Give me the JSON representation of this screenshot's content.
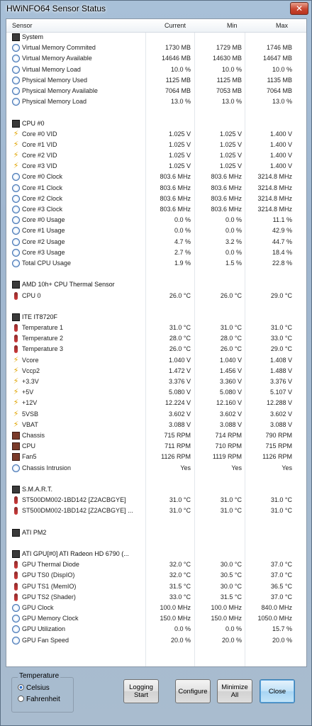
{
  "window": {
    "title": "HWiNFO64 Sensor Status"
  },
  "columns": {
    "sensor": "Sensor",
    "current": "Current",
    "min": "Min",
    "max": "Max"
  },
  "rows": [
    {
      "type": "group",
      "icon": "chip",
      "name": "System"
    },
    {
      "icon": "clock",
      "name": "Virtual Memory Commited",
      "cur": "1730 MB",
      "min": "1729 MB",
      "max": "1746 MB"
    },
    {
      "icon": "clock",
      "name": "Virtual Memory Available",
      "cur": "14646 MB",
      "min": "14630 MB",
      "max": "14647 MB"
    },
    {
      "icon": "clock",
      "name": "Virtual Memory Load",
      "cur": "10.0 %",
      "min": "10.0 %",
      "max": "10.0 %"
    },
    {
      "icon": "clock",
      "name": "Physical Memory Used",
      "cur": "1125 MB",
      "min": "1125 MB",
      "max": "1135 MB"
    },
    {
      "icon": "clock",
      "name": "Physical Memory Available",
      "cur": "7064 MB",
      "min": "7053 MB",
      "max": "7064 MB"
    },
    {
      "icon": "clock",
      "name": "Physical Memory Load",
      "cur": "13.0 %",
      "min": "13.0 %",
      "max": "13.0 %"
    },
    {
      "type": "spacer"
    },
    {
      "type": "group",
      "icon": "chip",
      "name": "CPU #0"
    },
    {
      "icon": "volt",
      "name": "Core #0 VID",
      "cur": "1.025 V",
      "min": "1.025 V",
      "max": "1.400 V"
    },
    {
      "icon": "volt",
      "name": "Core #1 VID",
      "cur": "1.025 V",
      "min": "1.025 V",
      "max": "1.400 V"
    },
    {
      "icon": "volt",
      "name": "Core #2 VID",
      "cur": "1.025 V",
      "min": "1.025 V",
      "max": "1.400 V"
    },
    {
      "icon": "volt",
      "name": "Core #3 VID",
      "cur": "1.025 V",
      "min": "1.025 V",
      "max": "1.400 V"
    },
    {
      "icon": "clock",
      "name": "Core #0 Clock",
      "cur": "803.6 MHz",
      "min": "803.6 MHz",
      "max": "3214.8 MHz"
    },
    {
      "icon": "clock",
      "name": "Core #1 Clock",
      "cur": "803.6 MHz",
      "min": "803.6 MHz",
      "max": "3214.8 MHz"
    },
    {
      "icon": "clock",
      "name": "Core #2 Clock",
      "cur": "803.6 MHz",
      "min": "803.6 MHz",
      "max": "3214.8 MHz"
    },
    {
      "icon": "clock",
      "name": "Core #3 Clock",
      "cur": "803.6 MHz",
      "min": "803.6 MHz",
      "max": "3214.8 MHz"
    },
    {
      "icon": "clock",
      "name": "Core #0 Usage",
      "cur": "0.0 %",
      "min": "0.0 %",
      "max": "11.1 %"
    },
    {
      "icon": "clock",
      "name": "Core #1 Usage",
      "cur": "0.0 %",
      "min": "0.0 %",
      "max": "42.9 %"
    },
    {
      "icon": "clock",
      "name": "Core #2 Usage",
      "cur": "4.7 %",
      "min": "3.2 %",
      "max": "44.7 %"
    },
    {
      "icon": "clock",
      "name": "Core #3 Usage",
      "cur": "2.7 %",
      "min": "0.0 %",
      "max": "18.4 %"
    },
    {
      "icon": "clock",
      "name": "Total CPU Usage",
      "cur": "1.9 %",
      "min": "1.5 %",
      "max": "22.8 %"
    },
    {
      "type": "spacer"
    },
    {
      "type": "group",
      "icon": "chip",
      "name": "AMD 10h+ CPU Thermal Sensor"
    },
    {
      "icon": "temp",
      "name": "CPU 0",
      "cur": "26.0 °C",
      "min": "26.0 °C",
      "max": "29.0 °C"
    },
    {
      "type": "spacer"
    },
    {
      "type": "group",
      "icon": "chip",
      "name": "ITE IT8720F"
    },
    {
      "icon": "temp",
      "name": "Temperature 1",
      "cur": "31.0 °C",
      "min": "31.0 °C",
      "max": "31.0 °C"
    },
    {
      "icon": "temp",
      "name": "Temperature 2",
      "cur": "28.0 °C",
      "min": "28.0 °C",
      "max": "33.0 °C"
    },
    {
      "icon": "temp",
      "name": "Temperature 3",
      "cur": "26.0 °C",
      "min": "26.0 °C",
      "max": "29.0 °C"
    },
    {
      "icon": "volt",
      "name": "Vcore",
      "cur": "1.040 V",
      "min": "1.040 V",
      "max": "1.408 V"
    },
    {
      "icon": "volt",
      "name": "Vccp2",
      "cur": "1.472 V",
      "min": "1.456 V",
      "max": "1.488 V"
    },
    {
      "icon": "volt",
      "name": "+3.3V",
      "cur": "3.376 V",
      "min": "3.360 V",
      "max": "3.376 V"
    },
    {
      "icon": "volt",
      "name": "+5V",
      "cur": "5.080 V",
      "min": "5.080 V",
      "max": "5.107 V"
    },
    {
      "icon": "volt",
      "name": "+12V",
      "cur": "12.224 V",
      "min": "12.160 V",
      "max": "12.288 V"
    },
    {
      "icon": "volt",
      "name": "5VSB",
      "cur": "3.602 V",
      "min": "3.602 V",
      "max": "3.602 V"
    },
    {
      "icon": "volt",
      "name": "VBAT",
      "cur": "3.088 V",
      "min": "3.088 V",
      "max": "3.088 V"
    },
    {
      "icon": "fan",
      "name": "Chassis",
      "cur": "715 RPM",
      "min": "714 RPM",
      "max": "790 RPM"
    },
    {
      "icon": "fan",
      "name": "CPU",
      "cur": "711 RPM",
      "min": "710 RPM",
      "max": "715 RPM"
    },
    {
      "icon": "fan",
      "name": "Fan5",
      "cur": "1126 RPM",
      "min": "1119 RPM",
      "max": "1126 RPM"
    },
    {
      "icon": "clock",
      "name": "Chassis Intrusion",
      "cur": "Yes",
      "min": "Yes",
      "max": "Yes"
    },
    {
      "type": "spacer"
    },
    {
      "type": "group",
      "icon": "chip",
      "name": "S.M.A.R.T."
    },
    {
      "icon": "temp",
      "name": "ST500DM002-1BD142 [Z2ACBGYE]",
      "cur": "31.0 °C",
      "min": "31.0 °C",
      "max": "31.0 °C"
    },
    {
      "icon": "temp",
      "name": "ST500DM002-1BD142 [Z2ACBGYE] ...",
      "cur": "31.0 °C",
      "min": "31.0 °C",
      "max": "31.0 °C"
    },
    {
      "type": "spacer"
    },
    {
      "type": "group",
      "icon": "chip",
      "name": "ATI PM2"
    },
    {
      "type": "spacer"
    },
    {
      "type": "group",
      "icon": "chip",
      "name": "ATI GPU[#0] ATI Radeon HD 6790 (..."
    },
    {
      "icon": "temp",
      "name": "GPU Thermal Diode",
      "cur": "32.0 °C",
      "min": "30.0 °C",
      "max": "37.0 °C"
    },
    {
      "icon": "temp",
      "name": "GPU TS0 (DispIO)",
      "cur": "32.0 °C",
      "min": "30.5 °C",
      "max": "37.0 °C"
    },
    {
      "icon": "temp",
      "name": "GPU TS1 (MemIO)",
      "cur": "31.5 °C",
      "min": "30.0 °C",
      "max": "36.5 °C"
    },
    {
      "icon": "temp",
      "name": "GPU TS2 (Shader)",
      "cur": "33.0 °C",
      "min": "31.5 °C",
      "max": "37.0 °C"
    },
    {
      "icon": "clock",
      "name": "GPU Clock",
      "cur": "100.0 MHz",
      "min": "100.0 MHz",
      "max": "840.0 MHz"
    },
    {
      "icon": "clock",
      "name": "GPU Memory Clock",
      "cur": "150.0 MHz",
      "min": "150.0 MHz",
      "max": "1050.0 MHz"
    },
    {
      "icon": "clock",
      "name": "GPU Utilization",
      "cur": "0.0 %",
      "min": "0.0 %",
      "max": "15.7 %"
    },
    {
      "icon": "clock",
      "name": "GPU Fan Speed",
      "cur": "20.0 %",
      "min": "20.0 %",
      "max": "20.0 %"
    }
  ],
  "temperature": {
    "legend": "Temperature",
    "celsius": "Celsius",
    "fahrenheit": "Fahrenheit",
    "selected": "celsius"
  },
  "buttons": {
    "logging": "Logging\nStart",
    "configure": "Configure",
    "minimize": "Minimize\nAll",
    "close": "Close"
  }
}
